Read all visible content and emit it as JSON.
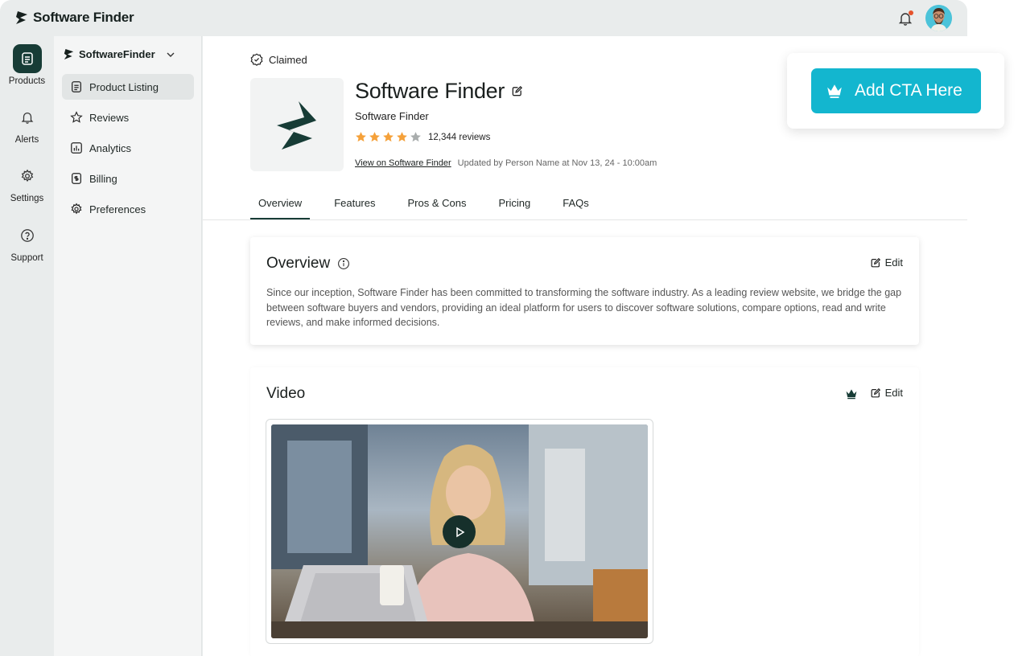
{
  "app": {
    "brand_name": "Software Finder"
  },
  "rail": {
    "items": [
      {
        "label": "Products",
        "icon": "document-icon"
      },
      {
        "label": "Alerts",
        "icon": "bell-icon"
      },
      {
        "label": "Settings",
        "icon": "gear-icon"
      },
      {
        "label": "Support",
        "icon": "help-circle-icon"
      }
    ]
  },
  "subnav": {
    "org_name": "SoftwareFinder",
    "items": [
      {
        "label": "Product Listing",
        "icon": "document-icon"
      },
      {
        "label": "Reviews",
        "icon": "star-icon"
      },
      {
        "label": "Analytics",
        "icon": "bar-chart-icon"
      },
      {
        "label": "Billing",
        "icon": "receipt-icon"
      },
      {
        "label": "Preferences",
        "icon": "gear-icon"
      }
    ]
  },
  "product": {
    "claimed_label": "Claimed",
    "title": "Software Finder",
    "subtitle": "Software Finder",
    "rating": 4,
    "rating_max": 5,
    "review_count": "12,344 reviews",
    "view_link": "View on Software Finder",
    "updated_text": "Updated by Person Name at Nov 13, 24 - 10:00am"
  },
  "tabs": [
    "Overview",
    "Features",
    "Pros & Cons",
    "Pricing",
    "FAQs"
  ],
  "overview": {
    "title": "Overview",
    "edit_label": "Edit",
    "body": "Since our inception, Software Finder has been committed to transforming the software industry. As a leading review website, we bridge the gap between software buyers and vendors, providing an ideal platform for users to discover software solutions, compare options, read and write reviews, and make informed decisions."
  },
  "video": {
    "title": "Video",
    "edit_label": "Edit"
  },
  "cta": {
    "label": "Add CTA Here"
  },
  "colors": {
    "brand_dark": "#173c36",
    "cta": "#13b6cf",
    "star": "#f5a13a",
    "notification": "#e5532c"
  }
}
